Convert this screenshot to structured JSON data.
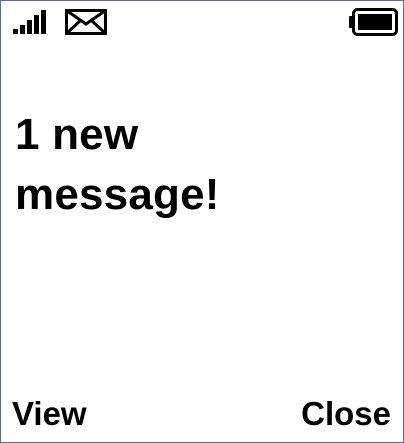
{
  "status_bar": {
    "icons": [
      "signal-strength-icon",
      "envelope-icon",
      "battery-full-icon"
    ]
  },
  "main": {
    "message_line1": "1 new",
    "message_line2": "message!"
  },
  "softkeys": {
    "left_label": "View",
    "right_label": "Close"
  },
  "colors": {
    "background": "#ffffff",
    "text": "#000000",
    "frame": "#5a6b8c"
  }
}
